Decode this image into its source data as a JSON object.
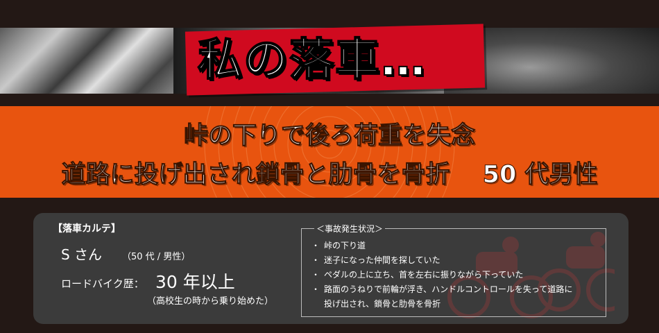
{
  "banner": {
    "title": "私の落車…",
    "colors": {
      "title_bg": "#d00a1f",
      "title_text": "#ffffff"
    }
  },
  "headline": {
    "line1": "峠の下りで後ろ荷重を失念",
    "line2": "道路に投げ出され鎖骨と肋骨を骨折　 50 代男性",
    "colors": {
      "background": "#e8540f"
    }
  },
  "karte": {
    "heading": "【落車カルテ】",
    "name": "S さん",
    "name_sub": "（50 代 / 男性）",
    "experience_label": "ロードバイク歴：",
    "experience_value": "30 年以上",
    "experience_note": "（高校生の時から乗り始めた）"
  },
  "situation": {
    "heading": "＜事故発生状況＞",
    "items": [
      "峠の下り道",
      "迷子になった仲間を探していた",
      "ペダルの上に立ち、首を左右に振りながら下っていた",
      "路面のうねりで前輪が浮き、ハンドルコントロールを失って道路に"
    ],
    "continuation": "投げ出され、鎖骨と肋骨を骨折"
  },
  "colors": {
    "page_bg": "#231815",
    "card_bg": "#3b3b3b"
  }
}
